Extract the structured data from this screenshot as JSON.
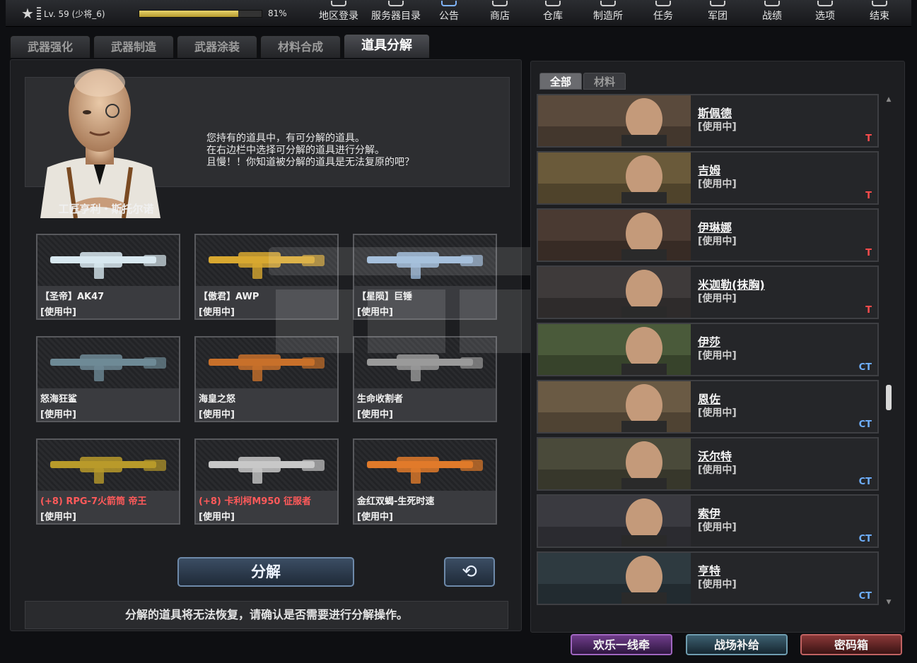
{
  "player": {
    "level_text": "Lv. 59 (少将_6)",
    "exp_percent_text": "81%",
    "exp_fraction": 0.81
  },
  "topnav": [
    {
      "label": "地区登录",
      "icon": "region-icon"
    },
    {
      "label": "服务器目录",
      "icon": "server-icon"
    },
    {
      "label": "公告",
      "icon": "megaphone-icon"
    },
    {
      "label": "商店",
      "icon": "shop-icon"
    },
    {
      "label": "仓库",
      "icon": "warehouse-icon"
    },
    {
      "label": "制造所",
      "icon": "factory-icon"
    },
    {
      "label": "任务",
      "icon": "mission-icon"
    },
    {
      "label": "军团",
      "icon": "clan-icon"
    },
    {
      "label": "战绩",
      "icon": "stats-icon"
    },
    {
      "label": "选项",
      "icon": "gear-icon"
    },
    {
      "label": "结束",
      "icon": "power-icon"
    }
  ],
  "tabs": [
    {
      "label": "武器强化"
    },
    {
      "label": "武器制造"
    },
    {
      "label": "武器涂装"
    },
    {
      "label": "材料合成"
    },
    {
      "label": "道具分解"
    }
  ],
  "npc": {
    "name": "工匠亨利・斯托尔诺",
    "lines": [
      "您持有的道具中，有可分解的道具。",
      "在右边栏中选择可分解的道具进行分解。",
      "且慢！！你知道被分解的道具是无法复原的吧？"
    ]
  },
  "items": [
    {
      "name": "【圣帝】AK47",
      "status": "[使用中]",
      "red": false,
      "icon": "ak47-icon"
    },
    {
      "name": "【傲君】AWP",
      "status": "[使用中]",
      "red": false,
      "icon": "awp-icon"
    },
    {
      "name": "【星陨】巨锤",
      "status": "[使用中]",
      "red": false,
      "icon": "hammer-icon"
    },
    {
      "name": "怒海狂鲨",
      "status": "[使用中]",
      "red": false,
      "icon": "shark-gun-icon"
    },
    {
      "name": "海皇之怒",
      "status": "[使用中]",
      "red": false,
      "icon": "trident-gun-icon"
    },
    {
      "name": "生命收割者",
      "status": "[使用中]",
      "red": false,
      "icon": "chainsaw-icon"
    },
    {
      "name": "(+8) RPG-7火箭筒 帝王",
      "status": "[使用中]",
      "red": true,
      "icon": "rpg-icon"
    },
    {
      "name": "(+8) 卡利柯M950 征服者",
      "status": "[使用中]",
      "red": true,
      "icon": "smg-icon"
    },
    {
      "name": "金红双蝎-生死时速",
      "status": "[使用中]",
      "red": false,
      "icon": "dual-pistols-icon"
    }
  ],
  "decompose_label": "分解",
  "warning": "分解的道具将无法恢复，请确认是否需要进行分解操作。",
  "right_tabs": [
    {
      "label": "全部"
    },
    {
      "label": "材料"
    }
  ],
  "characters": [
    {
      "name": "斯佩德",
      "status": "[使用中]",
      "team": "T"
    },
    {
      "name": "吉姆",
      "status": "[使用中]",
      "team": "T"
    },
    {
      "name": "伊琳娜",
      "status": "[使用中]",
      "team": "T"
    },
    {
      "name": "米迦勒(抹胸)",
      "status": "[使用中]",
      "team": "T"
    },
    {
      "name": "伊莎",
      "status": "[使用中]",
      "team": "CT"
    },
    {
      "name": "恩佐",
      "status": "[使用中]",
      "team": "CT"
    },
    {
      "name": "沃尔特",
      "status": "[使用中]",
      "team": "CT"
    },
    {
      "name": "索伊",
      "status": "[使用中]",
      "team": "CT"
    },
    {
      "name": "亨特",
      "status": "[使用中]",
      "team": "CT"
    }
  ],
  "bottom_buttons": [
    {
      "label": "欢乐一线牵"
    },
    {
      "label": "战场补给"
    },
    {
      "label": "密码箱"
    }
  ],
  "colors": {
    "red_item_text": "#ff5a5a",
    "t_team": "#ff4d4d",
    "ct_team": "#6fb0ff",
    "exp_bar": "#d6bd4c"
  }
}
